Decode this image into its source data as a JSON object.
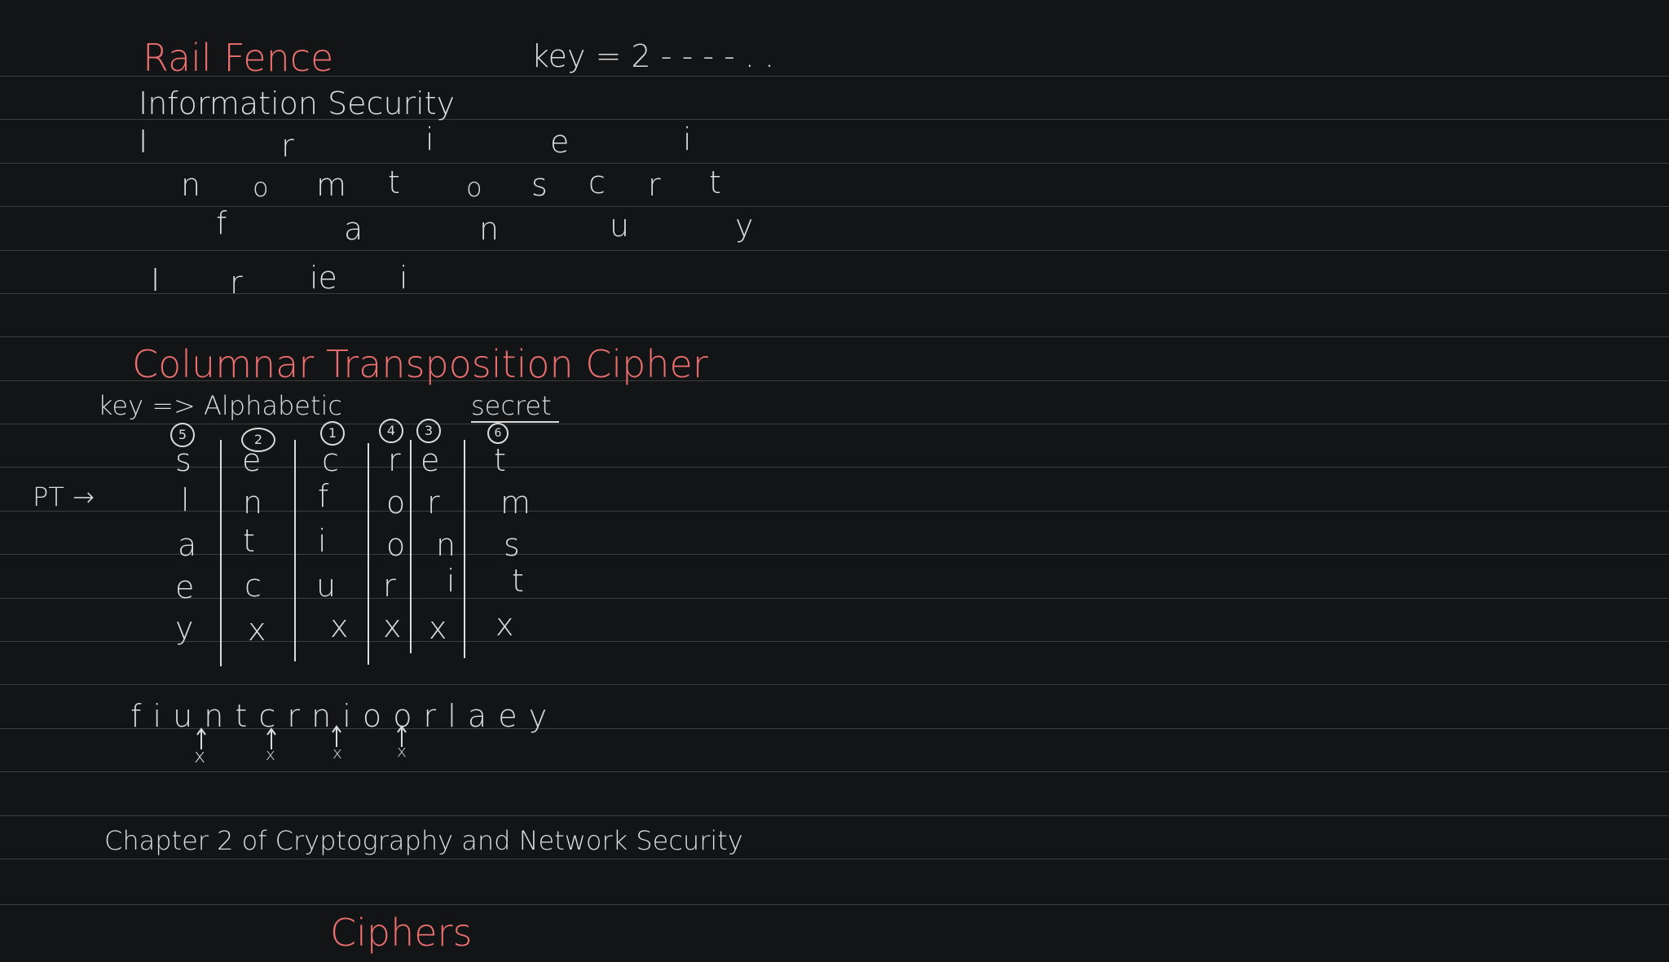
{
  "rail_fence": {
    "title": "Rail Fence",
    "key": "key = 2 - - - - . .",
    "plaintext": "Information Security",
    "rail1": [
      "I",
      "r",
      "i",
      "e",
      "i"
    ],
    "rail2": [
      "n",
      "o",
      "m",
      "t",
      "o",
      "s",
      "c",
      "r",
      "t"
    ],
    "rail3": [
      "f",
      "a",
      "n",
      "u",
      "y"
    ],
    "result": [
      "I",
      "r",
      "ie",
      "i"
    ]
  },
  "columnar": {
    "title": "Columnar Transposition Cipher",
    "key_label": "key => Alphabetic",
    "keyword": "secret",
    "pt_label": "PT →",
    "order": [
      "5",
      "2",
      "1",
      "4",
      "3",
      "6"
    ],
    "header": [
      "s",
      "e",
      "c",
      "r",
      "e",
      "t"
    ],
    "rows": [
      [
        "l",
        "n",
        "f",
        "o",
        "r",
        "m"
      ],
      [
        "a",
        "t",
        "i",
        "o",
        "n",
        "s"
      ],
      [
        "e",
        "c",
        "u",
        "r",
        "i",
        "t"
      ],
      [
        "y",
        "x",
        "x",
        "x",
        "x",
        "x"
      ]
    ],
    "ciphertext": "f i u n t c r n i o o r l a e y",
    "marks": [
      "x",
      "x",
      "x",
      "x"
    ]
  },
  "reference": "Chapter 2 of Cryptography and Network Security",
  "footer_title": "Ciphers",
  "colors": {
    "background": "#131416",
    "ink": "#dcdcdc",
    "heading": "#ec6f6f",
    "ruling": "#3b3d41"
  }
}
